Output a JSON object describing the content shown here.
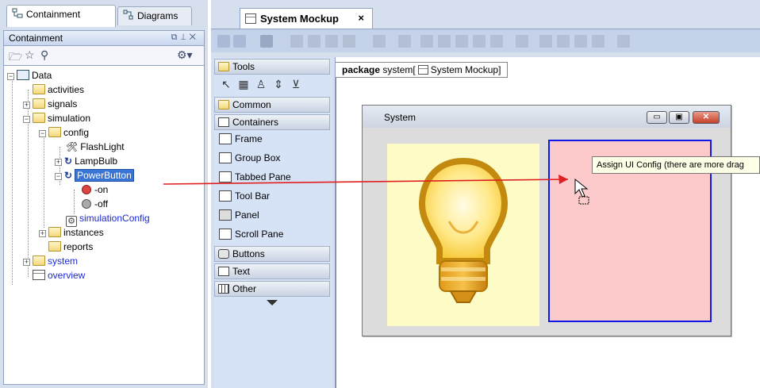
{
  "left_tabs": {
    "containment": "Containment",
    "diagrams": "Diagrams"
  },
  "panel": {
    "title": "Containment"
  },
  "tree": {
    "data": "Data",
    "activities": "activities",
    "signals": "signals",
    "simulation": "simulation",
    "config": "config",
    "flashlight": "FlashLight",
    "lampbulb": "LampBulb",
    "powerbutton": "PowerButton",
    "on": "-on",
    "off": "-off",
    "simulationconfig": "simulationConfig",
    "instances": "instances",
    "reports": "reports",
    "system": "system",
    "overview": "overview"
  },
  "editor": {
    "tab_label": "System Mockup",
    "close_label": "×"
  },
  "palette": {
    "tools": "Tools",
    "common": "Common",
    "containers": "Containers",
    "frame": "Frame",
    "group_box": "Group Box",
    "tabbed_pane": "Tabbed Pane",
    "tool_bar": "Tool Bar",
    "panel": "Panel",
    "scroll_pane": "Scroll Pane",
    "buttons": "Buttons",
    "text": "Text",
    "other": "Other"
  },
  "canvas": {
    "package_keyword": "package",
    "package_name": "system",
    "diagram_name": "System Mockup",
    "window_title": "System"
  },
  "tooltip": "Assign UI Config (there are more drag",
  "colors": {
    "selection": "#3875d7",
    "link": "#1a2ad6",
    "drag_arrow": "#e02020",
    "pink_panel": "#fccaca",
    "yellow_panel": "#fdfcc6",
    "panel_border": "#1018e6"
  }
}
